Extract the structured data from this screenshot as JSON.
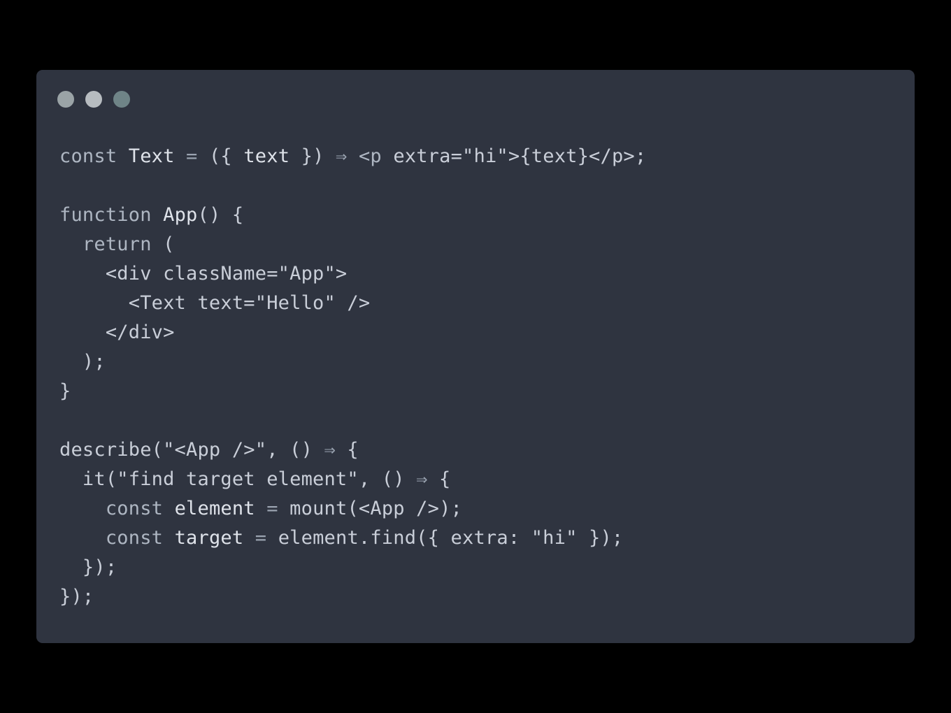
{
  "window": {
    "controls": [
      {
        "name": "close",
        "color": "#9aa3a6"
      },
      {
        "name": "minimize",
        "color": "#b7bcc0"
      },
      {
        "name": "zoom",
        "color": "#6f8487"
      }
    ],
    "background": "#2f3440"
  },
  "code": {
    "language": "jsx",
    "lines": [
      [
        {
          "text": "const",
          "role": "kw"
        },
        {
          "text": " ",
          "role": "pl"
        },
        {
          "text": "Text",
          "role": "id"
        },
        {
          "text": " ",
          "role": "pl"
        },
        {
          "text": "=",
          "role": "op"
        },
        {
          "text": " ({ ",
          "role": "pl"
        },
        {
          "text": "text",
          "role": "id"
        },
        {
          "text": " }) ",
          "role": "pl"
        },
        {
          "text": "⇒",
          "role": "op"
        },
        {
          "text": " ",
          "role": "pl"
        },
        {
          "text": "<p",
          "role": "kw"
        },
        {
          "text": " extra=\"hi\">{text}</p>;",
          "role": "pl"
        }
      ],
      [],
      [
        {
          "text": "function",
          "role": "kw"
        },
        {
          "text": " ",
          "role": "pl"
        },
        {
          "text": "App",
          "role": "id"
        },
        {
          "text": "() {",
          "role": "pl"
        }
      ],
      [
        {
          "text": "  ",
          "role": "pl"
        },
        {
          "text": "return",
          "role": "kw"
        },
        {
          "text": " (",
          "role": "pl"
        }
      ],
      [
        {
          "text": "    <div className=\"App\">",
          "role": "pl"
        }
      ],
      [
        {
          "text": "      <Text text=\"Hello\" />",
          "role": "pl"
        }
      ],
      [
        {
          "text": "    </div>",
          "role": "pl"
        }
      ],
      [
        {
          "text": "  );",
          "role": "pl"
        }
      ],
      [
        {
          "text": "}",
          "role": "pl"
        }
      ],
      [],
      [
        {
          "text": "describe(\"<App />\", () ",
          "role": "pl"
        },
        {
          "text": "⇒",
          "role": "op"
        },
        {
          "text": " {",
          "role": "pl"
        }
      ],
      [
        {
          "text": "  it(\"find target element\", () ",
          "role": "pl"
        },
        {
          "text": "⇒",
          "role": "op"
        },
        {
          "text": " {",
          "role": "pl"
        }
      ],
      [
        {
          "text": "    ",
          "role": "pl"
        },
        {
          "text": "const",
          "role": "kw"
        },
        {
          "text": " ",
          "role": "pl"
        },
        {
          "text": "element",
          "role": "id"
        },
        {
          "text": " ",
          "role": "pl"
        },
        {
          "text": "=",
          "role": "op"
        },
        {
          "text": " mount(<App />);",
          "role": "pl"
        }
      ],
      [
        {
          "text": "    ",
          "role": "pl"
        },
        {
          "text": "const",
          "role": "kw"
        },
        {
          "text": " ",
          "role": "pl"
        },
        {
          "text": "target",
          "role": "id"
        },
        {
          "text": " ",
          "role": "pl"
        },
        {
          "text": "=",
          "role": "op"
        },
        {
          "text": " element.find({ extra: \"hi\" });",
          "role": "pl"
        }
      ],
      [
        {
          "text": "  });",
          "role": "pl"
        }
      ],
      [
        {
          "text": "});",
          "role": "pl"
        }
      ]
    ]
  }
}
